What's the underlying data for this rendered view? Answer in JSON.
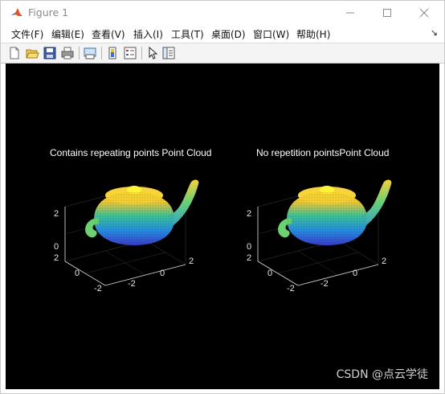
{
  "window": {
    "title": "Figure 1"
  },
  "menus": [
    "文件(F)",
    "编辑(E)",
    "查看(V)",
    "插入(I)",
    "工具(T)",
    "桌面(D)",
    "窗口(W)",
    "帮助(H)"
  ],
  "menu_overflow": "↘",
  "toolbar": [
    "new-figure-icon",
    "open-file-icon",
    "save-icon",
    "print-icon",
    "print-preview-icon",
    "colorbar-icon",
    "legend-icon",
    "pointer-icon",
    "property-editor-icon"
  ],
  "plots": [
    {
      "title": "Contains repeating points Point Cloud",
      "z_ticks": [
        "0",
        "2"
      ],
      "y_ticks": [
        "2",
        "0",
        "-2"
      ],
      "x_ticks": [
        "-2",
        "0",
        "2"
      ]
    },
    {
      "title": "No repetition pointsPoint Cloud",
      "z_ticks": [
        "0",
        "2"
      ],
      "y_ticks": [
        "2",
        "0",
        "-2"
      ],
      "x_ticks": [
        "-2",
        "0",
        "2"
      ]
    }
  ],
  "watermark": "CSDN @点云学徒",
  "colors": {
    "canvas": "#000000",
    "teapot_top": "#f9e21d",
    "teapot_mid": "#2fb5a0",
    "teapot_low": "#3a4ed8"
  }
}
